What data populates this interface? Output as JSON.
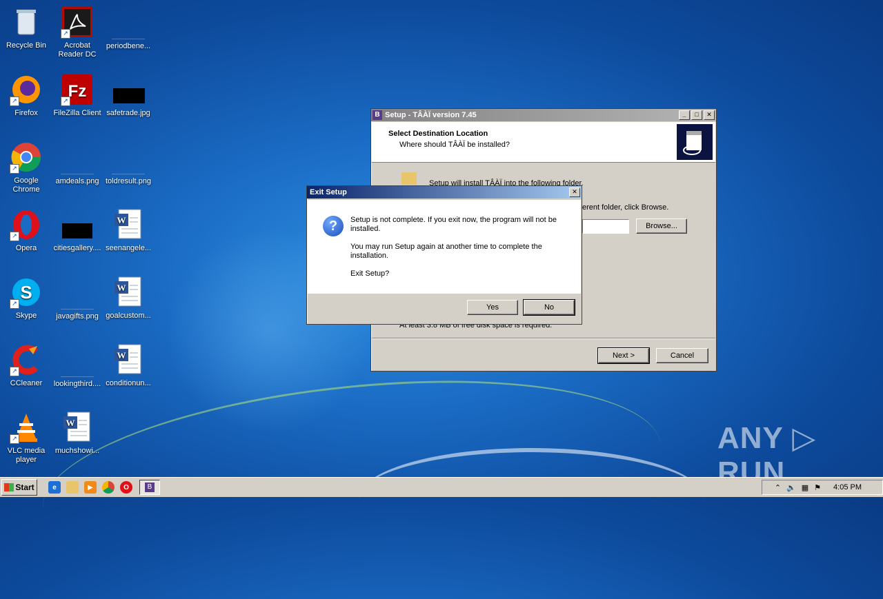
{
  "desktop": {
    "icons": [
      {
        "label": "Recycle Bin"
      },
      {
        "label": "Acrobat Reader DC"
      },
      {
        "label": "periodbene..."
      },
      {
        "label": "Firefox"
      },
      {
        "label": "FileZilla Client"
      },
      {
        "label": "safetrade.jpg"
      },
      {
        "label": "Google Chrome"
      },
      {
        "label": "amdeals.png"
      },
      {
        "label": "toldresult.png"
      },
      {
        "label": "Opera"
      },
      {
        "label": "citiesgallery...."
      },
      {
        "label": "seenangele..."
      },
      {
        "label": "Skype"
      },
      {
        "label": "javagifts.png"
      },
      {
        "label": "goalcustom..."
      },
      {
        "label": "CCleaner"
      },
      {
        "label": "lookingthird...."
      },
      {
        "label": "conditionun..."
      },
      {
        "label": "VLC media player"
      },
      {
        "label": "muchshowi..."
      }
    ]
  },
  "setup_window": {
    "title": "Setup - TÂÀÏ version 7.45",
    "heading": "Select Destination Location",
    "subheading": "Where should TÂÀÏ be installed?",
    "install_line": "Setup will install TÂÀÏ into the following folder.",
    "browse_hint": "erent folder, click Browse.",
    "browse_label": "Browse...",
    "disk_space": "At least 3.8 MB of free disk space is required.",
    "next_label": "Next >",
    "cancel_label": "Cancel"
  },
  "exit_dialog": {
    "title": "Exit Setup",
    "line1": "Setup is not complete. If you exit now, the program will not be installed.",
    "line2": "You may run Setup again at another time to complete the installation.",
    "line3": "Exit Setup?",
    "yes_label": "Yes",
    "no_label": "No"
  },
  "taskbar": {
    "start_label": "Start",
    "clock": "4:05 PM"
  },
  "watermark": "ANY ▷ RUN"
}
